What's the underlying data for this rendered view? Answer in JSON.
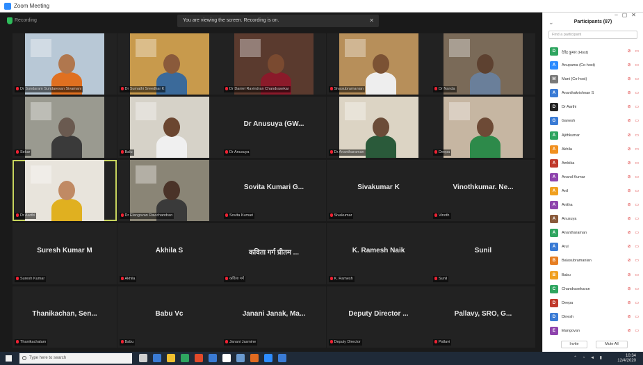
{
  "window": {
    "title": "Zoom Meeting"
  },
  "topbar": {
    "status_label": "Recording",
    "banner_text": "You are viewing the screen. Recording is on.",
    "banner_close": "✕"
  },
  "tiles": [
    {
      "name": "Dr Sundaram Sundaresan Sivamani",
      "center": "",
      "video": true,
      "bg": "#b8c8d6",
      "skin": "#b0774e",
      "shirt": "#e07020"
    },
    {
      "name": "Dr Sumathi Sreedhar K",
      "center": "",
      "video": true,
      "bg": "#c89a4c",
      "skin": "#8a5a3b",
      "shirt": "#3b6a9a"
    },
    {
      "name": "Dr Daniel Ravindran Chandrasekar",
      "center": "",
      "video": true,
      "bg": "#5a3a2e",
      "skin": "#7a4a30",
      "shirt": "#8b1a2a"
    },
    {
      "name": "Sivasubramanian",
      "center": "",
      "video": true,
      "bg": "#b78f5a",
      "skin": "#7b5234",
      "shirt": "#eeeeee"
    },
    {
      "name": "Dr Nanda",
      "center": "",
      "video": true,
      "bg": "#7a6a58",
      "skin": "#5d4130",
      "shirt": "#6a7f9a"
    },
    {
      "name": "Sekar",
      "center": "",
      "video": true,
      "bg": "#9a9a90",
      "skin": "#6a5a50",
      "shirt": "#3a3a3a"
    },
    {
      "name": "Balu",
      "center": "",
      "video": true,
      "bg": "#d6d2c8",
      "skin": "#6b4630",
      "shirt": "#f0f0f0"
    },
    {
      "name": "Dr Anusuya",
      "center": "Dr Anusuya (GW...",
      "video": false
    },
    {
      "name": "Dr Anantharaman",
      "center": "",
      "video": true,
      "bg": "#dcd4c4",
      "skin": "#6b4c38",
      "shirt": "#2a5a3a"
    },
    {
      "name": "Deepa",
      "center": "",
      "video": true,
      "bg": "#c6b6a2",
      "skin": "#6d4a36",
      "shirt": "#2d8a4a"
    },
    {
      "name": "Dr Aarthi",
      "center": "",
      "video": true,
      "bg": "#e8e4dc",
      "skin": "#c08a64",
      "shirt": "#e0b020",
      "active": true
    },
    {
      "name": "Dr Elangovan Ravichandran",
      "center": "",
      "video": true,
      "bg": "#8a8576",
      "skin": "#4a3328",
      "shirt": "#3a3a3a"
    },
    {
      "name": "Sovita Kumari",
      "center": "Sovita Kumari G...",
      "video": false
    },
    {
      "name": "Sivakumar",
      "center": "Sivakumar K",
      "video": false
    },
    {
      "name": "Vinoth",
      "center": "Vinothkumar. Ne...",
      "video": false
    },
    {
      "name": "Suresh Kumar",
      "center": "Suresh Kumar M",
      "video": false
    },
    {
      "name": "Akhila",
      "center": "Akhila S",
      "video": false
    },
    {
      "name": "कविता गर्ग",
      "center": "कविता गर्ग प्रीतम ...",
      "video": false
    },
    {
      "name": "K. Ramesh",
      "center": "K. Ramesh Naik",
      "video": false
    },
    {
      "name": "Sunil",
      "center": "Sunil",
      "video": false
    },
    {
      "name": "Thanikachalam",
      "center": "Thanikachan, Sen...",
      "video": false
    },
    {
      "name": "Babu",
      "center": "Babu Vc",
      "video": false
    },
    {
      "name": "Janani Jasmine",
      "center": "Janani Janak, Ma...",
      "video": false
    },
    {
      "name": "Deputy Director",
      "center": "Deputy Director ...",
      "video": false
    },
    {
      "name": "Pallavi",
      "center": "Pallavy, SRO, G...",
      "video": false
    }
  ],
  "panel": {
    "title": "Participants (87)",
    "search_placeholder": "Find a participant",
    "participants": [
      {
        "name": "देवेंद्र कुमार (Host)",
        "color": "#2fa560",
        "initial": "D"
      },
      {
        "name": "Anupama (Co-host)",
        "color": "#2d8cff",
        "initial": "A"
      },
      {
        "name": "Mani (Co-host)",
        "color": "#7a7a7a",
        "initial": "M"
      },
      {
        "name": "Ananthakrishnan S",
        "color": "#3a7bd5",
        "initial": "A"
      },
      {
        "name": "Dr Aarthi",
        "color": "#222222",
        "initial": "D"
      },
      {
        "name": "Ganesh",
        "color": "#3a7bd5",
        "initial": "G"
      },
      {
        "name": "Ajithkumar",
        "color": "#2fa560",
        "initial": "A"
      },
      {
        "name": "Akhila",
        "color": "#f09020",
        "initial": "A"
      },
      {
        "name": "Ambika",
        "color": "#c0392b",
        "initial": "A"
      },
      {
        "name": "Anand Kumar",
        "color": "#8e44ad",
        "initial": "A"
      },
      {
        "name": "Anil",
        "color": "#f0a020",
        "initial": "A"
      },
      {
        "name": "Anitha",
        "color": "#8e44ad",
        "initial": "A"
      },
      {
        "name": "Anusuya",
        "color": "#8a5a3b",
        "initial": "A"
      },
      {
        "name": "Anantharaman",
        "color": "#2fa560",
        "initial": "A"
      },
      {
        "name": "Arul",
        "color": "#3a7bd5",
        "initial": "A"
      },
      {
        "name": "Balasubramanian",
        "color": "#e67e22",
        "initial": "B"
      },
      {
        "name": "Babu",
        "color": "#f0a020",
        "initial": "B"
      },
      {
        "name": "Chandrasekaran",
        "color": "#2fa560",
        "initial": "C"
      },
      {
        "name": "Deepa",
        "color": "#c0392b",
        "initial": "D"
      },
      {
        "name": "Dinesh",
        "color": "#3a7bd5",
        "initial": "D"
      },
      {
        "name": "Elangovan",
        "color": "#8e44ad",
        "initial": "E"
      }
    ],
    "invite_label": "Invite",
    "mute_all_label": "Mute All"
  },
  "taskbar": {
    "search_placeholder": "Type here to search",
    "time": "10:34",
    "date": "12/4/2020",
    "app_colors": [
      "#cfcfcf",
      "#3a7bd5",
      "#f0c030",
      "#2fa560",
      "#e04a2a",
      "#3a7bd5",
      "#ffffff",
      "#6a9ad0",
      "#e06a20",
      "#2d8cff",
      "#3a7bd5"
    ]
  }
}
